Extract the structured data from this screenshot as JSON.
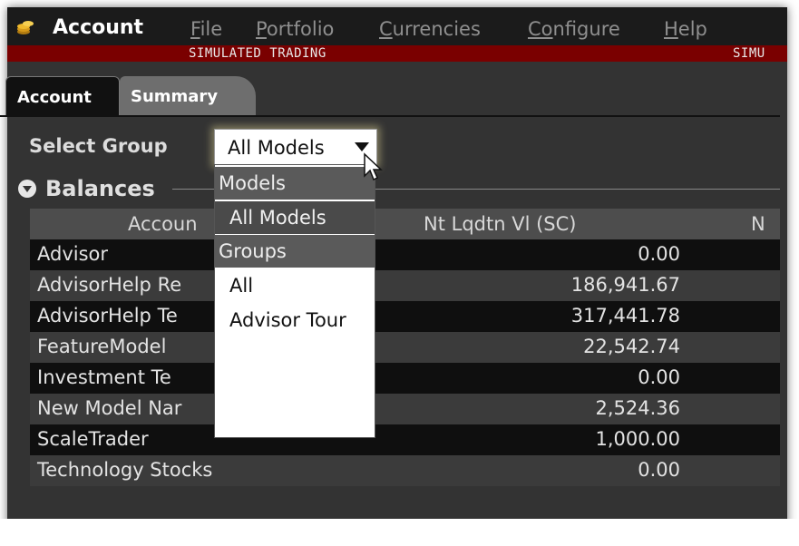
{
  "window": {
    "title": "Account",
    "menu": [
      {
        "first": "F",
        "rest": "ile"
      },
      {
        "first": "P",
        "rest": "ortfolio"
      },
      {
        "first": "C",
        "rest": "urrencies"
      },
      {
        "first": "Co",
        "rest": "nfigure"
      },
      {
        "first": "H",
        "rest": "elp"
      }
    ],
    "simulated_label": "SIMULATED TRADING",
    "simulated_label_right": "SIMU"
  },
  "tabs": {
    "account": "Account",
    "summary": "Summary"
  },
  "select_group": {
    "label": "Select Group",
    "value": "All Models"
  },
  "dropdown": {
    "sections": [
      {
        "header": "Models",
        "items": [
          "All Models"
        ]
      },
      {
        "header": "Groups",
        "items": [
          "All",
          "Advisor Tour"
        ]
      }
    ],
    "selected": "All Models"
  },
  "balances": {
    "title": "Balances",
    "columns": [
      "Accoun",
      "Nt Lqdtn Vl (SC)",
      "N"
    ],
    "rows": [
      {
        "name": "Advisor",
        "value": "0.00"
      },
      {
        "name": "AdvisorHelp Re",
        "value": "186,941.67"
      },
      {
        "name": "AdvisorHelp Te",
        "value": "317,441.78"
      },
      {
        "name": "FeatureModel",
        "value": "22,542.74"
      },
      {
        "name": "Investment Te",
        "value": "0.00"
      },
      {
        "name": "New Model Nar",
        "value": "2,524.36"
      },
      {
        "name": "ScaleTrader",
        "value": "1,000.00"
      },
      {
        "name": "Technology Stocks",
        "value": "0.00"
      }
    ]
  },
  "colors": {
    "title_bar": "#1b1b1b",
    "simulated_bar": "#7a0000",
    "panel": "#333333",
    "row_dark": "#0f0f0f",
    "row_light": "#3b3b3b"
  },
  "icons": {
    "app": "gold-coins-icon",
    "balances_toggle": "collapse-circle-icon",
    "select_caret": "caret-down-icon",
    "cursor": "mouse-pointer-icon"
  }
}
